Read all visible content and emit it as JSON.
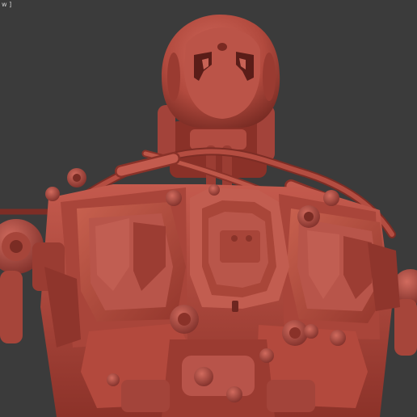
{
  "viewport": {
    "label": "w ]",
    "background": "#3b3b3b",
    "model_color": "#b34a3f"
  }
}
